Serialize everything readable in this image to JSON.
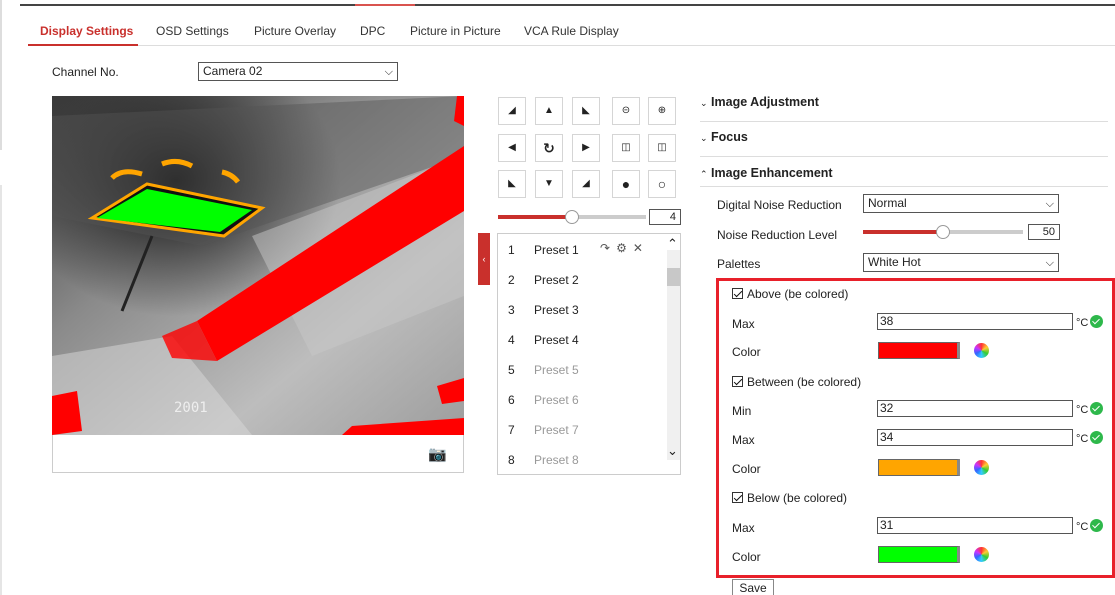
{
  "tabs": [
    "Display Settings",
    "OSD Settings",
    "Picture Overlay",
    "DPC",
    "Picture in Picture",
    "VCA Rule Display"
  ],
  "channel": {
    "label": "Channel No.",
    "value": "Camera 02"
  },
  "video": {
    "osd_text": "2001",
    "snapshot_icon": "camera-icon"
  },
  "ptz": {
    "buttons": [
      "arrow-up-left",
      "arrow-up",
      "arrow-up-right",
      "zoom-out",
      "zoom-in",
      "arrow-left",
      "auto-rotate",
      "arrow-right",
      "focus-near",
      "focus-far",
      "arrow-down-left",
      "arrow-down",
      "arrow-down-right",
      "iris-close",
      "iris-open"
    ],
    "speed": "4"
  },
  "presets": {
    "items": [
      {
        "num": "1",
        "name": "Preset 1"
      },
      {
        "num": "2",
        "name": "Preset 2"
      },
      {
        "num": "3",
        "name": "Preset 3"
      },
      {
        "num": "4",
        "name": "Preset 4"
      },
      {
        "num": "5",
        "name": "Preset 5"
      },
      {
        "num": "6",
        "name": "Preset 6"
      },
      {
        "num": "7",
        "name": "Preset 7"
      },
      {
        "num": "8",
        "name": "Preset 8"
      }
    ],
    "actions": [
      "call-icon",
      "gear-icon",
      "close-icon"
    ]
  },
  "image": {
    "adjustment": "Image Adjustment",
    "focus": "Focus",
    "enhancement": "Image Enhancement",
    "dnr_label": "Digital Noise Reduction",
    "dnr_value": "Normal",
    "nr_level_label": "Noise Reduction Level",
    "nr_level_value": "50",
    "palettes_label": "Palettes",
    "palettes_value": "White Hot"
  },
  "palette_rules": {
    "above_label": "Above (be colored)",
    "between_label": "Between (be colored)",
    "below_label": "Below (be colored)",
    "max_label": "Max",
    "min_label": "Min",
    "color_label": "Color",
    "unit": "°C",
    "above_max": "38",
    "between_min": "32",
    "between_max": "34",
    "below_max": "31",
    "above_color": "#ff0000",
    "between_color": "#ffa500",
    "below_color": "#00ff00"
  },
  "save_label": "Save"
}
